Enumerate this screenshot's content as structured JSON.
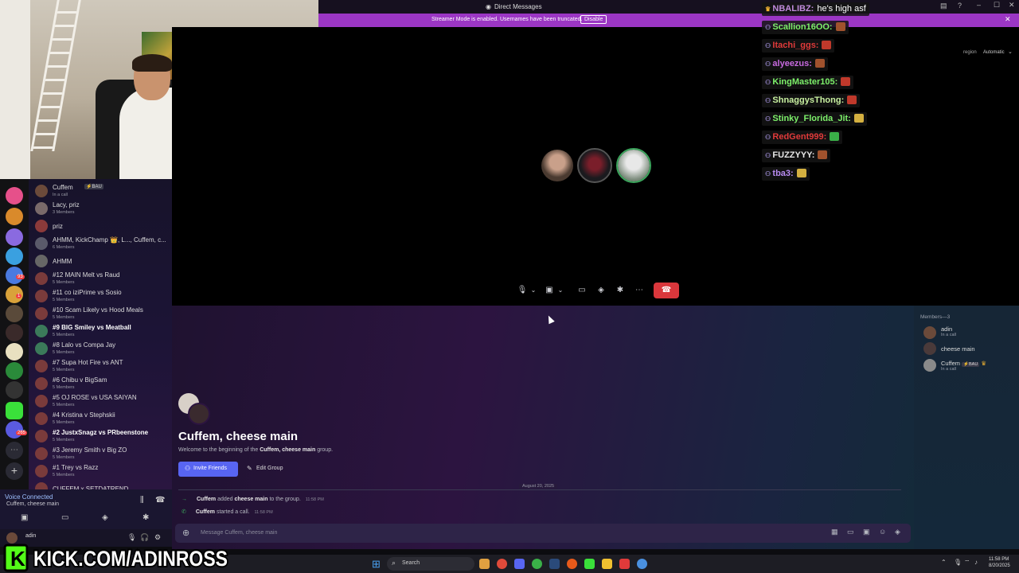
{
  "window": {
    "title": "Direct Messages",
    "streamer_banner": "Streamer Mode is enabled. Usernames have been truncated.",
    "disable_label": "Disable",
    "region_label": "region",
    "region_value": "Automatic"
  },
  "servers": {
    "badges": [
      "93",
      "1",
      "265"
    ]
  },
  "dm_list": [
    {
      "name": "Cuffem",
      "tag": "⚡BAU",
      "sub": "In a call",
      "avatar": "#6b4a3a"
    },
    {
      "name": "Lacy, priz",
      "sub": "3 Members",
      "avatar": "#7a6a6a"
    },
    {
      "name": "priz",
      "sub": "",
      "avatar": "#8b3a3a"
    },
    {
      "name": "AHMM, KickChamp 👑, L..., Cuffem, c...",
      "sub": "6 Members",
      "avatar": "#5a5a6a"
    },
    {
      "name": "AHMM",
      "sub": "",
      "avatar": "#666"
    },
    {
      "name": "#12 MAIN Melt vs Raud",
      "sub": "5 Members",
      "avatar": "#7a3b3b"
    },
    {
      "name": "#11 co iziPrime vs Sosio",
      "sub": "5 Members",
      "avatar": "#7a3b3b"
    },
    {
      "name": "#10 Scam Likely vs Hood Meals",
      "sub": "5 Members",
      "avatar": "#7a3b3b"
    },
    {
      "name": "#9 BIG Smiley vs Meatball",
      "sub": "5 Members",
      "avatar": "#3b7a5a",
      "bold": true
    },
    {
      "name": "#8 Lalo vs Compa Jay",
      "sub": "5 Members",
      "avatar": "#3b7a5a"
    },
    {
      "name": "#7 Supa Hot Fire vs ANT",
      "sub": "5 Members",
      "avatar": "#7a3b3b"
    },
    {
      "name": "#6 Chibu v BigSam",
      "sub": "5 Members",
      "avatar": "#7a3b3b"
    },
    {
      "name": "#5 OJ ROSE vs USA SAIYAN",
      "sub": "5 Members",
      "avatar": "#7a3b3b"
    },
    {
      "name": "#4 Kristina v Stephskii",
      "sub": "5 Members",
      "avatar": "#7a3b3b"
    },
    {
      "name": "#2 JustxSnagz vs PRbeenstone",
      "sub": "5 Members",
      "avatar": "#7a3b3b",
      "bold": true
    },
    {
      "name": "#3 Jeremy Smith v Big ZO",
      "sub": "5 Members",
      "avatar": "#7a3b3b"
    },
    {
      "name": "#1 Trey vs Razz",
      "sub": "5 Members",
      "avatar": "#7a3b3b"
    },
    {
      "name": "CUFFEM x SETDATREND",
      "sub": "",
      "avatar": "#7a3b3b"
    }
  ],
  "voice": {
    "status": "Voice Connected",
    "channel": "Cuffem, cheese main"
  },
  "user": {
    "name": "adin"
  },
  "channel": {
    "title": "Cuffem, cheese main",
    "welcome_prefix": "Welcome to the beginning of the ",
    "welcome_name": "Cuffem, cheese main",
    "welcome_suffix": " group.",
    "invite_label": "Invite Friends",
    "edit_label": "Edit Group",
    "date_divider": "August 20, 2025",
    "messages": [
      {
        "actor": "Cuffem",
        "text": " added ",
        "target": "cheese main",
        "rest": " to the group.",
        "time": "11:58 PM"
      },
      {
        "actor": "Cuffem",
        "text": " started a call.",
        "target": "",
        "rest": "",
        "time": "11:58 PM"
      }
    ],
    "input_placeholder": "Message Cuffem, cheese main"
  },
  "members": {
    "header": "Members—3",
    "list": [
      {
        "name": "adin",
        "sub": "In a call",
        "avatar": "#6b4a3a"
      },
      {
        "name": "cheese main",
        "sub": "",
        "avatar": "#4a3a3a"
      },
      {
        "name": "Cuffem",
        "tag": "⚡BAU",
        "sub": "In a call",
        "avatar": "#8a8a8a"
      }
    ]
  },
  "stream_chat": [
    {
      "user": "NBALIBZ:",
      "color": "#c08bdc",
      "msg": "he's high asf"
    },
    {
      "user": "Scallion16OO:",
      "color": "#7df06a",
      "msg": ""
    },
    {
      "user": "Itachi_ggs:",
      "color": "#e03a3a",
      "msg": ""
    },
    {
      "user": "alyeezus:",
      "color": "#c86ae0",
      "msg": ""
    },
    {
      "user": "KingMaster105:",
      "color": "#7df06a",
      "msg": ""
    },
    {
      "user": "ShnaggysThong:",
      "color": "#c8f0a0",
      "msg": ""
    },
    {
      "user": "Stinky_Florida_Jit:",
      "color": "#7df06a",
      "msg": ""
    },
    {
      "user": "RedGent999:",
      "color": "#e03a3a",
      "msg": ""
    },
    {
      "user": "FUZZYYY:",
      "color": "#e6e6e6",
      "msg": ""
    },
    {
      "user": "tba3:",
      "color": "#b88cf0",
      "msg": ""
    }
  ],
  "taskbar": {
    "search_label": "Search",
    "time": "11:58 PM",
    "date": "8/20/2025"
  },
  "overlay": {
    "kick_text": "KICK.COM/ADINROSS"
  }
}
